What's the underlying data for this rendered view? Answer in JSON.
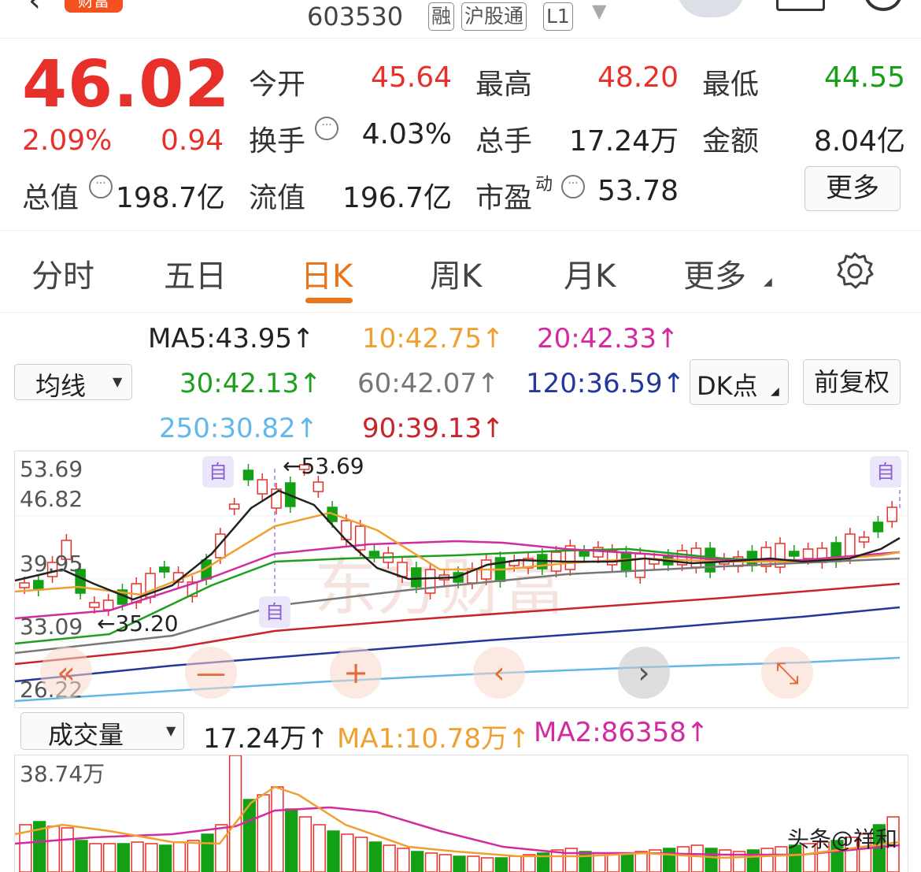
{
  "header": {
    "back_glyph": "‹",
    "badge": "财富",
    "code": "603530",
    "tags": [
      "融",
      "沪股通",
      "L1"
    ],
    "caret": "▼"
  },
  "quote": {
    "price": "46.02",
    "change_pct": "2.09%",
    "change_val": "0.94",
    "stats": [
      {
        "label": "今开",
        "value": "45.64",
        "color": "red"
      },
      {
        "label": "最高",
        "value": "48.20",
        "color": "red"
      },
      {
        "label": "最低",
        "value": "44.55",
        "color": "green"
      },
      {
        "label": "换手",
        "value": "4.03%",
        "color": "black"
      },
      {
        "label": "总手",
        "value": "17.24万",
        "color": "black"
      },
      {
        "label": "金额",
        "value": "8.04亿",
        "color": "black"
      },
      {
        "label": "总值",
        "value": "198.7亿",
        "color": "black"
      },
      {
        "label": "流值",
        "value": "196.7亿",
        "color": "black"
      },
      {
        "label": "市盈",
        "sup": "动",
        "value": "53.78",
        "color": "black"
      }
    ],
    "more_label": "更多",
    "dots_glyph": "···"
  },
  "tabs": [
    "分时",
    "五日",
    "日K",
    "周K",
    "月K",
    "更多"
  ],
  "ma_select": "均线",
  "ma_legend": [
    {
      "text": "MA5:43.95↑",
      "color": "#222222"
    },
    {
      "text": "10:42.75↑",
      "color": "#f0a030"
    },
    {
      "text": "20:42.33↑",
      "color": "#d42aa0"
    },
    {
      "text": "30:42.13↑",
      "color": "#1ea01e"
    },
    {
      "text": "60:42.07↑",
      "color": "#777777"
    },
    {
      "text": "120:36.59↑",
      "color": "#24379a"
    },
    {
      "text": "250:30.82↑",
      "color": "#62b8e8"
    },
    {
      "text": "90:39.13↑",
      "color": "#c8242c"
    }
  ],
  "buttons": {
    "dk": "DK点",
    "fq": "前复权"
  },
  "kline": {
    "y_labels": [
      "53.69",
      "46.82",
      "39.95",
      "33.09",
      "26.22"
    ],
    "max_annot": "←53.69",
    "min_annot": "←35.20",
    "zi": "自",
    "nav": [
      "«",
      "—",
      "+",
      "‹",
      "›",
      "⤡"
    ],
    "watermark": "东方财富"
  },
  "volume": {
    "select": "成交量",
    "vol": "17.24万↑",
    "ma1": "MA1:10.78万↑",
    "ma2": "MA2:86358↑",
    "y_label": "38.74万"
  },
  "colors": {
    "up": "#e8302a",
    "down": "#14a014",
    "accent": "#e8741c"
  },
  "footer_watermark": "头条@祥和"
}
